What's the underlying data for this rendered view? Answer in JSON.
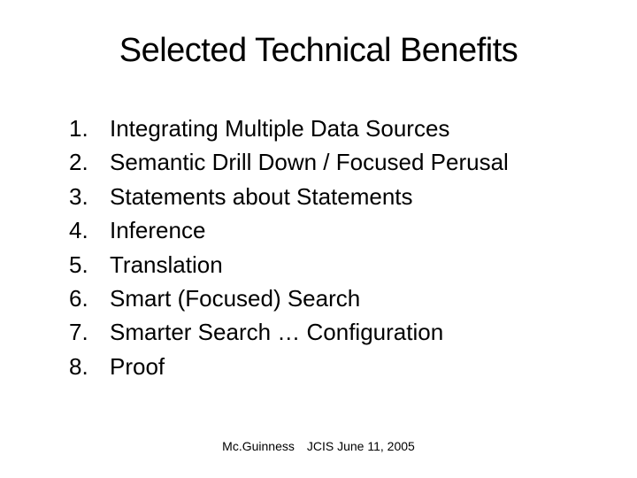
{
  "title": "Selected Technical Benefits",
  "items": [
    {
      "num": "1.",
      "text": "Integrating Multiple Data Sources"
    },
    {
      "num": "2.",
      "text": "Semantic Drill Down / Focused Perusal"
    },
    {
      "num": "3.",
      "text": "Statements about Statements"
    },
    {
      "num": "4.",
      "text": "Inference"
    },
    {
      "num": "5.",
      "text": "Translation"
    },
    {
      "num": "6.",
      "text": "Smart (Focused) Search"
    },
    {
      "num": "7.",
      "text": "Smarter Search … Configuration"
    },
    {
      "num": "8.",
      "text": "Proof"
    }
  ],
  "footer": {
    "author": "Mc.Guinness",
    "event": "JCIS  June 11, 2005"
  }
}
